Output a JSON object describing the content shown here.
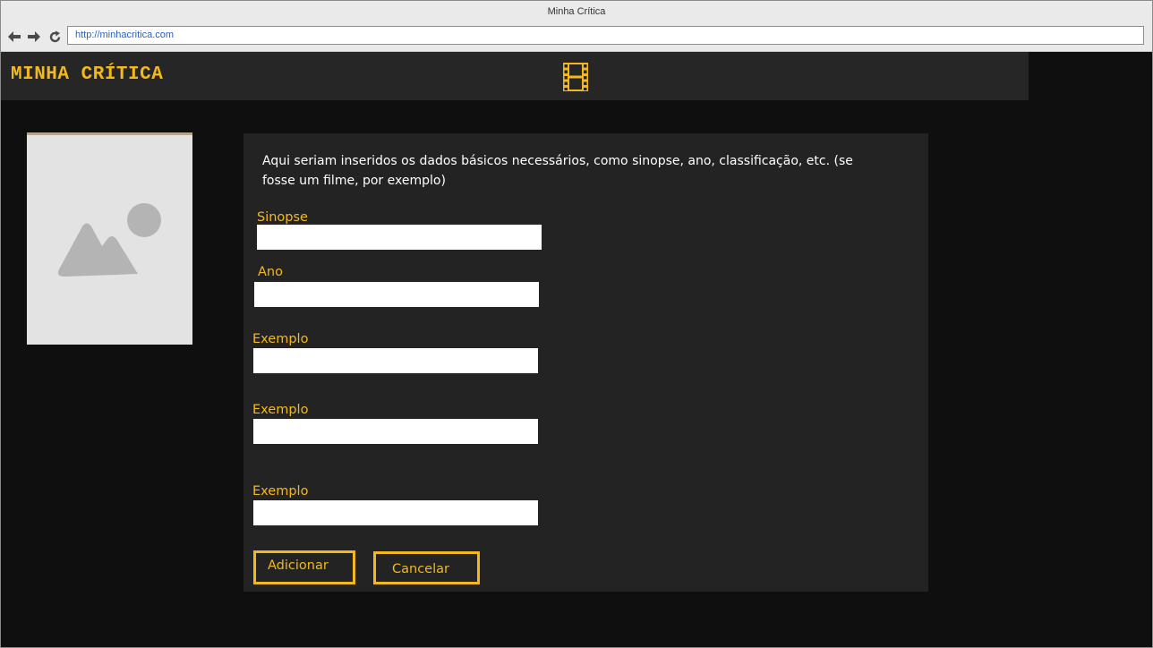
{
  "window": {
    "title": "Minha Crítica"
  },
  "toolbar": {
    "back_icon": "back-arrow-icon",
    "forward_icon": "forward-arrow-icon",
    "reload_icon": "reload-icon",
    "url": "http://minhacritica.com"
  },
  "header": {
    "brand": "MINHA CRÍTICA",
    "logo_icon": "film-strip-icon"
  },
  "image_placeholder": {
    "icon": "image-placeholder-icon"
  },
  "form": {
    "description": "Aqui seriam inseridos os dados básicos necessários, como sinopse, ano, classificação, etc. (se fosse um filme, por exemplo)",
    "fields": [
      {
        "label": "Sinopse",
        "value": ""
      },
      {
        "label": "Ano",
        "value": ""
      },
      {
        "label": "Exemplo",
        "value": ""
      },
      {
        "label": "Exemplo",
        "value": ""
      },
      {
        "label": "Exemplo",
        "value": ""
      }
    ],
    "add_label": "Adicionar",
    "cancel_label": "Cancelar"
  },
  "colors": {
    "accent": "#f2b81e",
    "panel": "#232323",
    "background": "#0f0f0f",
    "header": "#262626"
  }
}
